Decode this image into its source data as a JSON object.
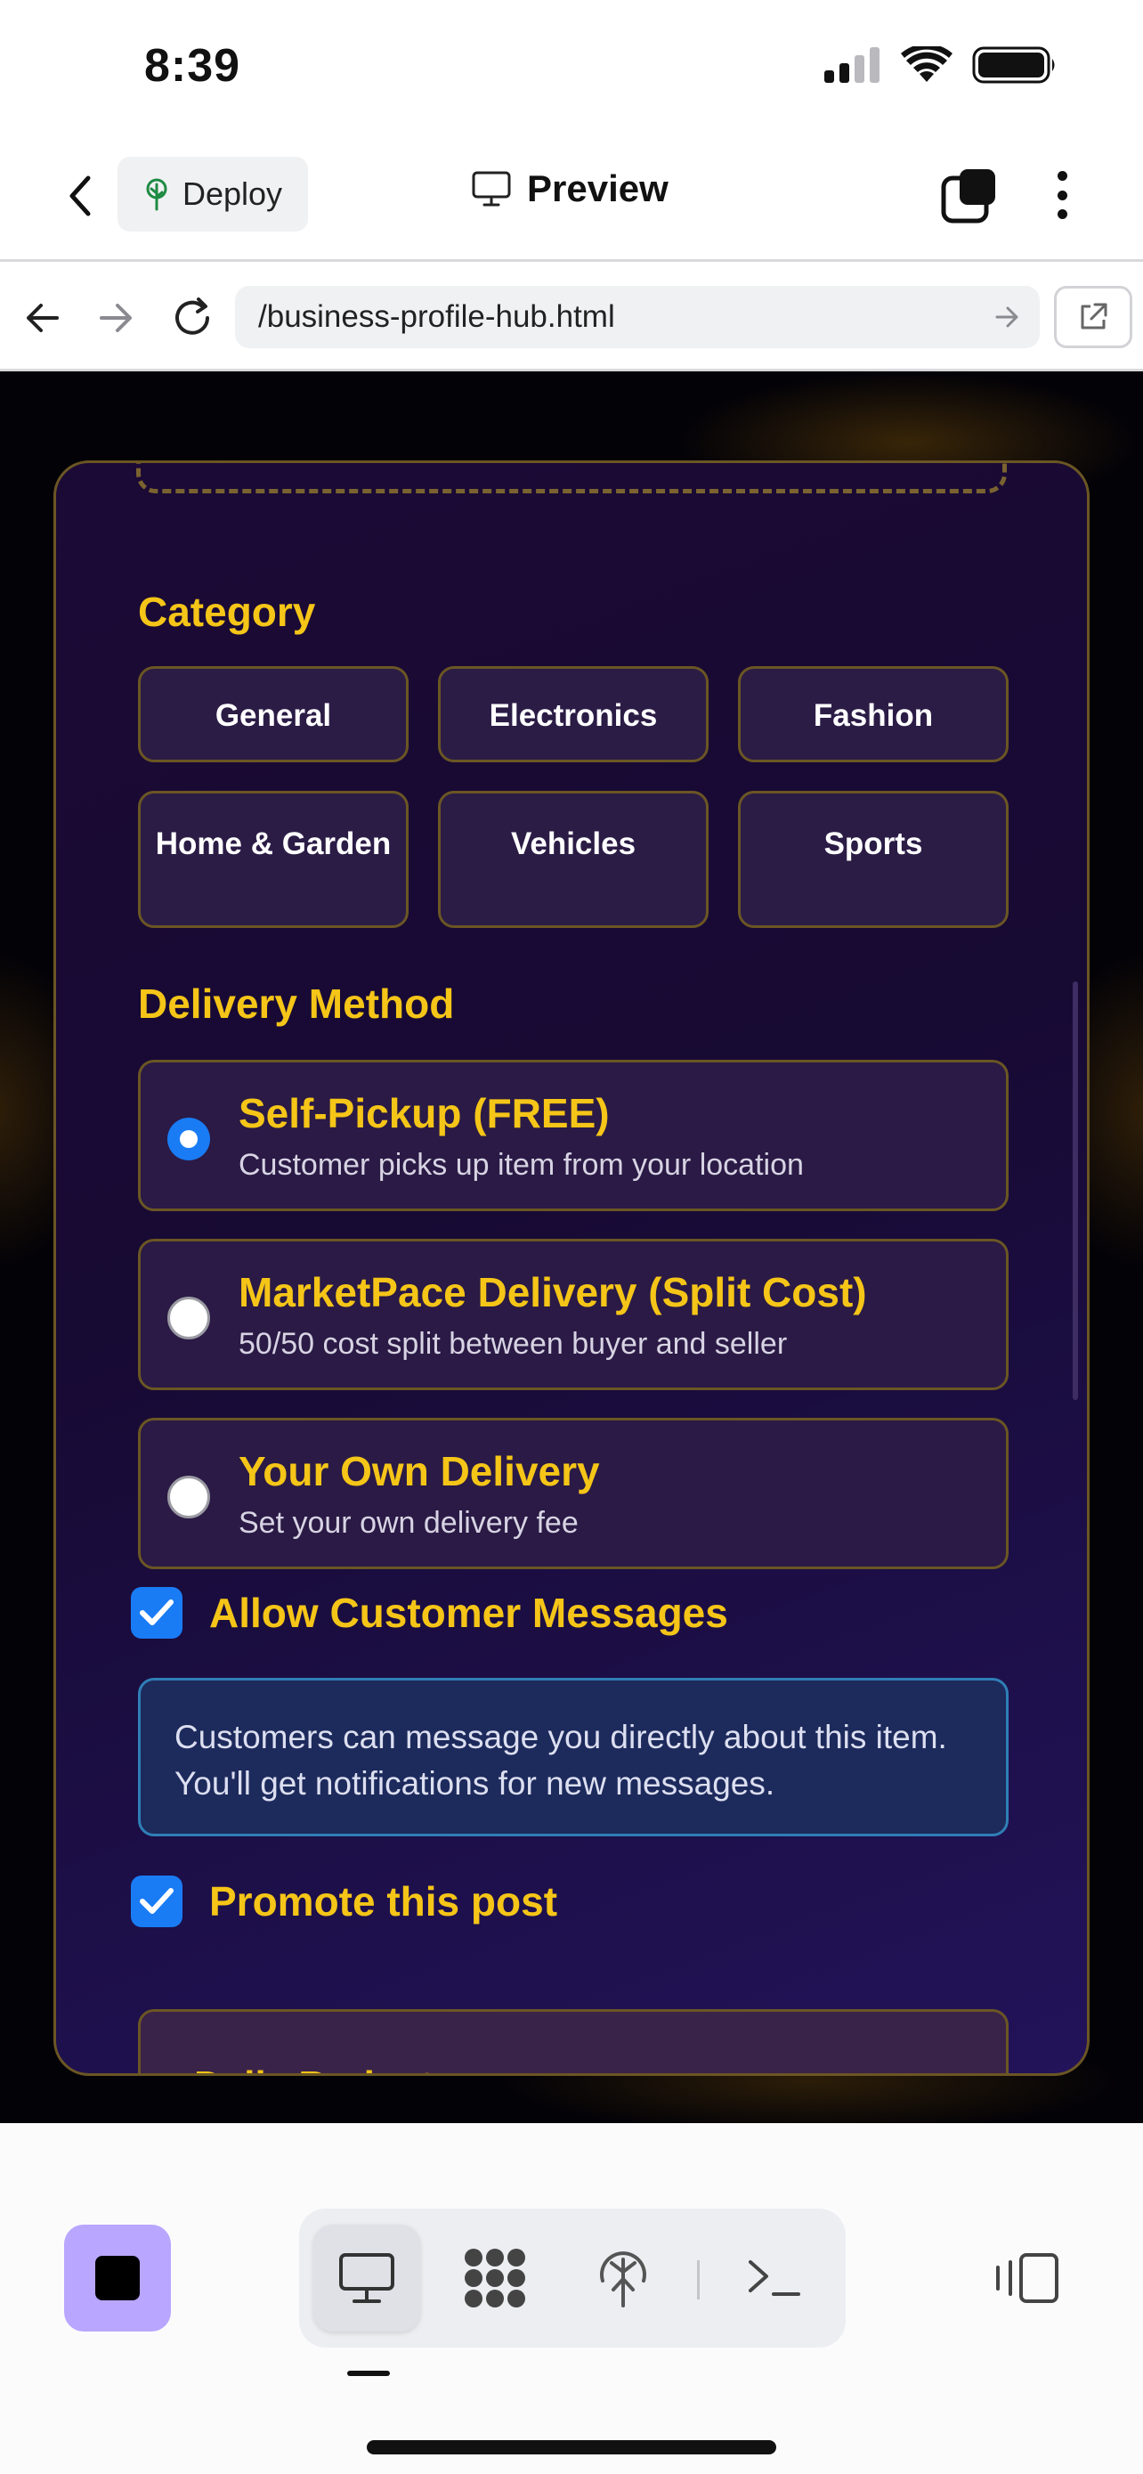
{
  "status_bar": {
    "time": "8:39"
  },
  "top_bar": {
    "deploy_label": "Deploy",
    "preview_label": "Preview"
  },
  "url_bar": {
    "url": "/business-profile-hub.html"
  },
  "form": {
    "category": {
      "title": "Category",
      "options": [
        "General",
        "Electronics",
        "Fashion",
        "Home & Garden",
        "Vehicles",
        "Sports"
      ]
    },
    "delivery": {
      "title": "Delivery Method",
      "options": [
        {
          "title": "Self-Pickup (FREE)",
          "description": "Customer picks up item from your location",
          "selected": true
        },
        {
          "title": "MarketPace Delivery (Split Cost)",
          "description": "50/50 cost split between buyer and seller",
          "selected": false
        },
        {
          "title": "Your Own Delivery",
          "description": "Set your own delivery fee",
          "selected": false
        }
      ]
    },
    "messages": {
      "label": "Allow Customer Messages",
      "checked": true,
      "info": "Customers can message you directly about this item. You'll get notifications for new messages."
    },
    "promote": {
      "label": "Promote this post",
      "checked": true,
      "budget_label": "Daily Budget"
    }
  },
  "colors": {
    "accent_gold": "#f5c518",
    "checkbox_blue": "#1a7cf5",
    "card_border": "#6b5624",
    "stop_button": "#b9a6ff"
  },
  "icons": [
    "back-icon",
    "tree-icon",
    "monitor-icon",
    "tabs-icon",
    "more-icon",
    "arrow-left-icon",
    "arrow-right-icon",
    "reload-icon",
    "external-link-icon",
    "stop-icon",
    "desktop-icon",
    "apps-icon",
    "deploy-icon",
    "terminal-icon",
    "panel-icon"
  ]
}
